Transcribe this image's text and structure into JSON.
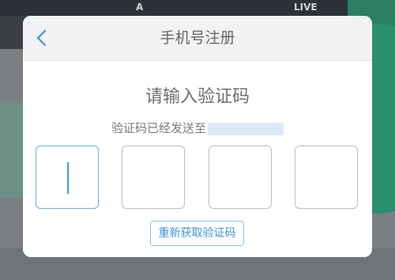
{
  "background": {
    "tab_a": "A",
    "tab_live": "LIVE"
  },
  "dialog": {
    "title": "手机号注册",
    "back_icon": "chevron-left-icon",
    "heading": "请输入验证码",
    "sent_prefix": "验证码已经发送至",
    "code_boxes": [
      "",
      "",
      "",
      ""
    ],
    "active_box_index": 0,
    "resend_label": "重新获取验证码"
  },
  "colors": {
    "accent": "#3c95d8",
    "overlay": "#7a7f83",
    "masked_phone": "#dceaf8"
  }
}
